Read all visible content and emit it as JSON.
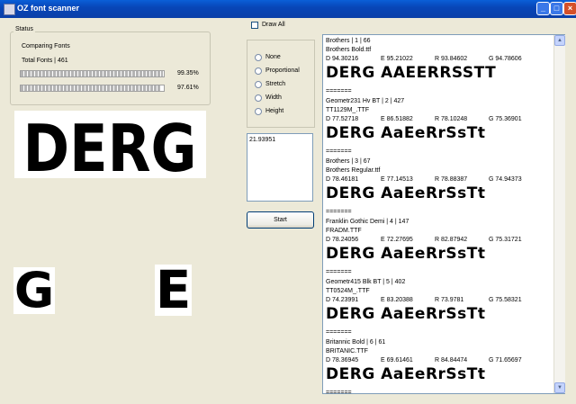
{
  "window": {
    "title": "OZ font scanner",
    "minimize": "_",
    "maximize": "□",
    "close": "×"
  },
  "status": {
    "group_label": "Status",
    "comparing": "Comparing Fonts",
    "total": "Total Fonts | 461",
    "progress1": {
      "label": "99.35%",
      "value": 0.9935
    },
    "progress2": {
      "label": "97.61%",
      "value": 0.9761
    }
  },
  "options": {
    "draw_all_label": "Draw All",
    "draw_all_checked": false,
    "radios": [
      "None",
      "Proportional",
      "Stretch",
      "Width",
      "Height"
    ]
  },
  "score_value": "21.93951",
  "start_label": "Start",
  "preview": {
    "word": "DERG",
    "glyphs": [
      "G",
      "E"
    ]
  },
  "results": [
    {
      "header": "Brothers | 1 | 66",
      "file": "Brothers Bold.ttf",
      "d": "D 94.30216",
      "e": "E 95.21022",
      "r": "R 93.84602",
      "g": "G 94.78606",
      "sample": "DERG AAEERRSSTT"
    },
    {
      "header": "Geometr231 Hv BT | 2 | 427",
      "file": "TT1129M_.TTF",
      "d": "D 77.52718",
      "e": "E 86.51882",
      "r": "R 78.10248",
      "g": "G 75.36901",
      "sample": "DERG AaEeRrSsTt"
    },
    {
      "header": "Brothers | 3 | 67",
      "file": "Brothers Regular.ttf",
      "d": "D 78.46181",
      "e": "E 77.14513",
      "r": "R 78.88387",
      "g": "G 74.94373",
      "sample": "DERG AaEeRrSsTt"
    },
    {
      "header": "Franklin Gothic Demi | 4 | 147",
      "file": "FRADM.TTF",
      "d": "D 78.24056",
      "e": "E 72.27695",
      "r": "R 82.87942",
      "g": "G 75.31721",
      "sample": "DERG AaEeRrSsTt"
    },
    {
      "header": "Geometr415 Blk BT | 5 | 402",
      "file": "TT0524M_.TTF",
      "d": "D 74.23991",
      "e": "E 83.20388",
      "r": "R 73.9781",
      "g": "G 75.58321",
      "sample": "DERG AaEeRrSsTt"
    },
    {
      "header": "Britannic Bold | 6 | 61",
      "file": "BRITANIC.TTF",
      "d": "D 78.36945",
      "e": "E 69.61461",
      "r": "R 84.84474",
      "g": "G 71.65697",
      "sample": "DERG AaEeRrSsTt"
    }
  ],
  "separator": "======="
}
